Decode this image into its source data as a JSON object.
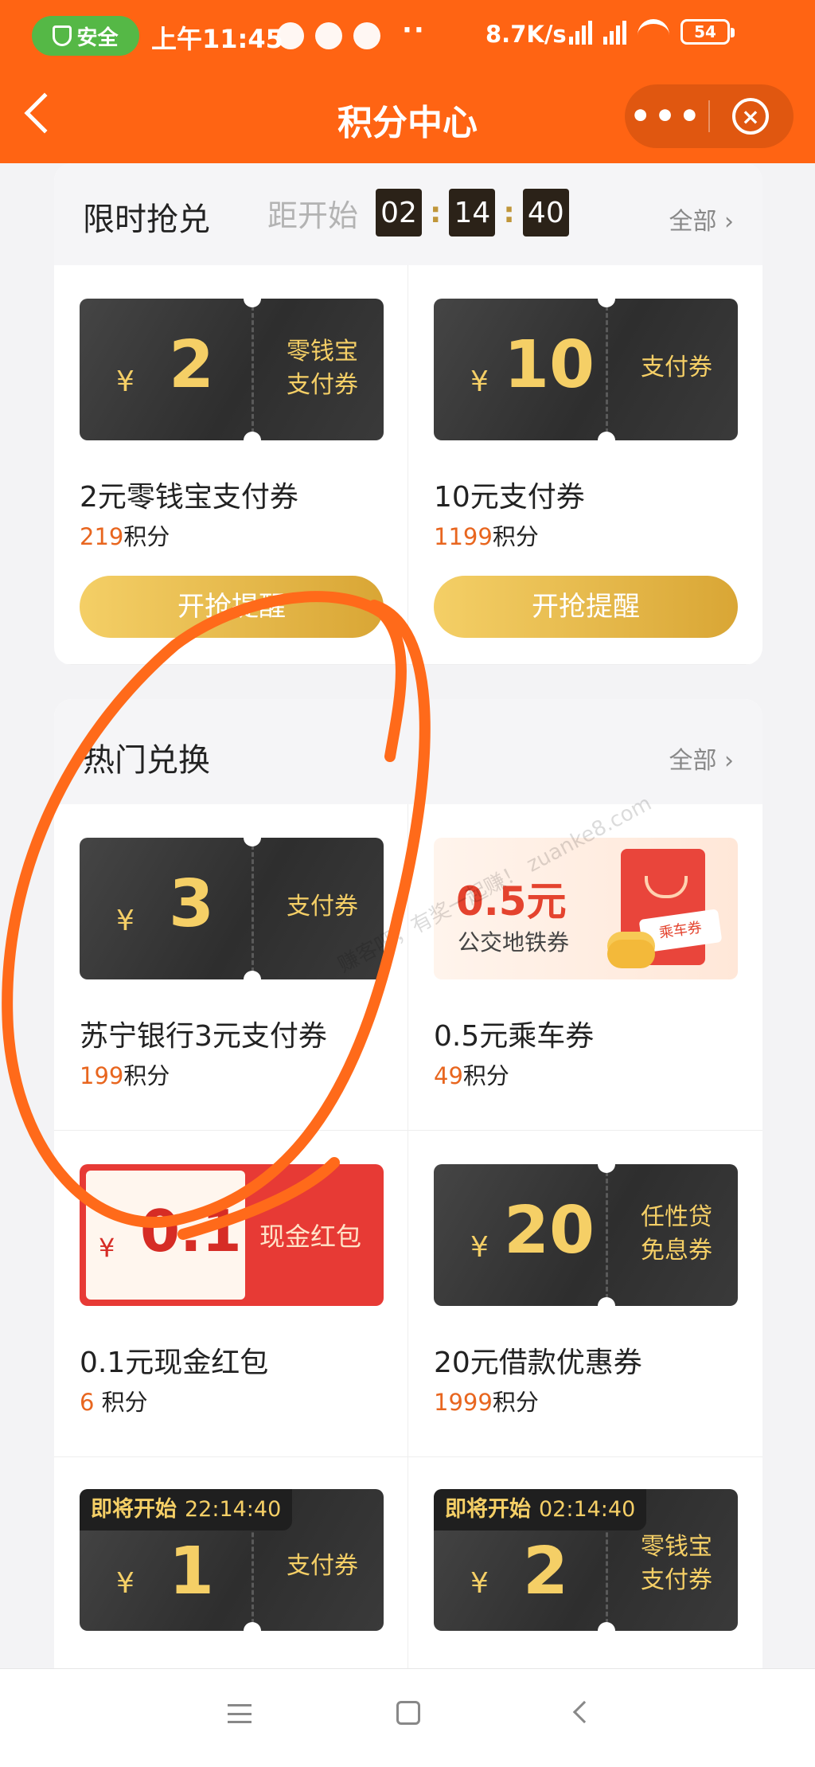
{
  "status_bar": {
    "safe_label": "安全",
    "time": "上午11:45",
    "dots": "··",
    "net_speed": "8.7K/s",
    "battery": "54"
  },
  "nav": {
    "title": "积分中心",
    "more_glyph": "•••",
    "close_glyph": "×"
  },
  "flash_sale": {
    "title": "限时抢兑",
    "countdown_label": "距开始",
    "countdown": [
      "02",
      "14",
      "40"
    ],
    "all_label": "全部 ›",
    "items": [
      {
        "yen": "¥",
        "amount": "2",
        "type_line1": "零钱宝",
        "type_line2": "支付券",
        "name": "2元零钱宝支付券",
        "points": "219",
        "points_unit": "积分",
        "button": "开抢提醒"
      },
      {
        "yen": "¥",
        "amount": "10",
        "type_line1": "支付券",
        "name": "10元支付券",
        "points": "1199",
        "points_unit": "积分",
        "button": "开抢提醒"
      }
    ]
  },
  "hot": {
    "title": "热门兑换",
    "all_label": "全部 ›",
    "items": [
      {
        "yen": "¥",
        "amount": "3",
        "type_line1": "支付券",
        "name": "苏宁银行3元支付券",
        "points": "199",
        "points_unit": "积分"
      },
      {
        "amount": "0.5元",
        "type_line1": "公交地铁券",
        "tag": "乘车券",
        "name": "0.5元乘车券",
        "points": "49",
        "points_unit": "积分"
      },
      {
        "yen": "¥",
        "amount": "0.1",
        "type_line1": "现金红包",
        "name": "0.1元现金红包",
        "points": "6",
        "points_unit": " 积分"
      },
      {
        "yen": "¥",
        "amount": "20",
        "type_line1": "任性贷",
        "type_line2": "免息券",
        "name": "20元借款优惠券",
        "points": "1999",
        "points_unit": "积分"
      },
      {
        "badge_label": "即将开始",
        "badge_time": "22:14:40",
        "yen": "¥",
        "amount": "1",
        "type_line1": "支付券"
      },
      {
        "badge_label": "即将开始",
        "badge_time": "02:14:40",
        "yen": "¥",
        "amount": "2",
        "type_line1": "零钱宝",
        "type_line2": "支付券"
      }
    ]
  },
  "watermark": "赚客吧，有奖一起赚！ zuanke8.com",
  "colors": {
    "brand_orange": "#ff6413",
    "gold": "#f5cf66",
    "points_orange": "#e8661f",
    "annotation": "#ff6a1a"
  }
}
